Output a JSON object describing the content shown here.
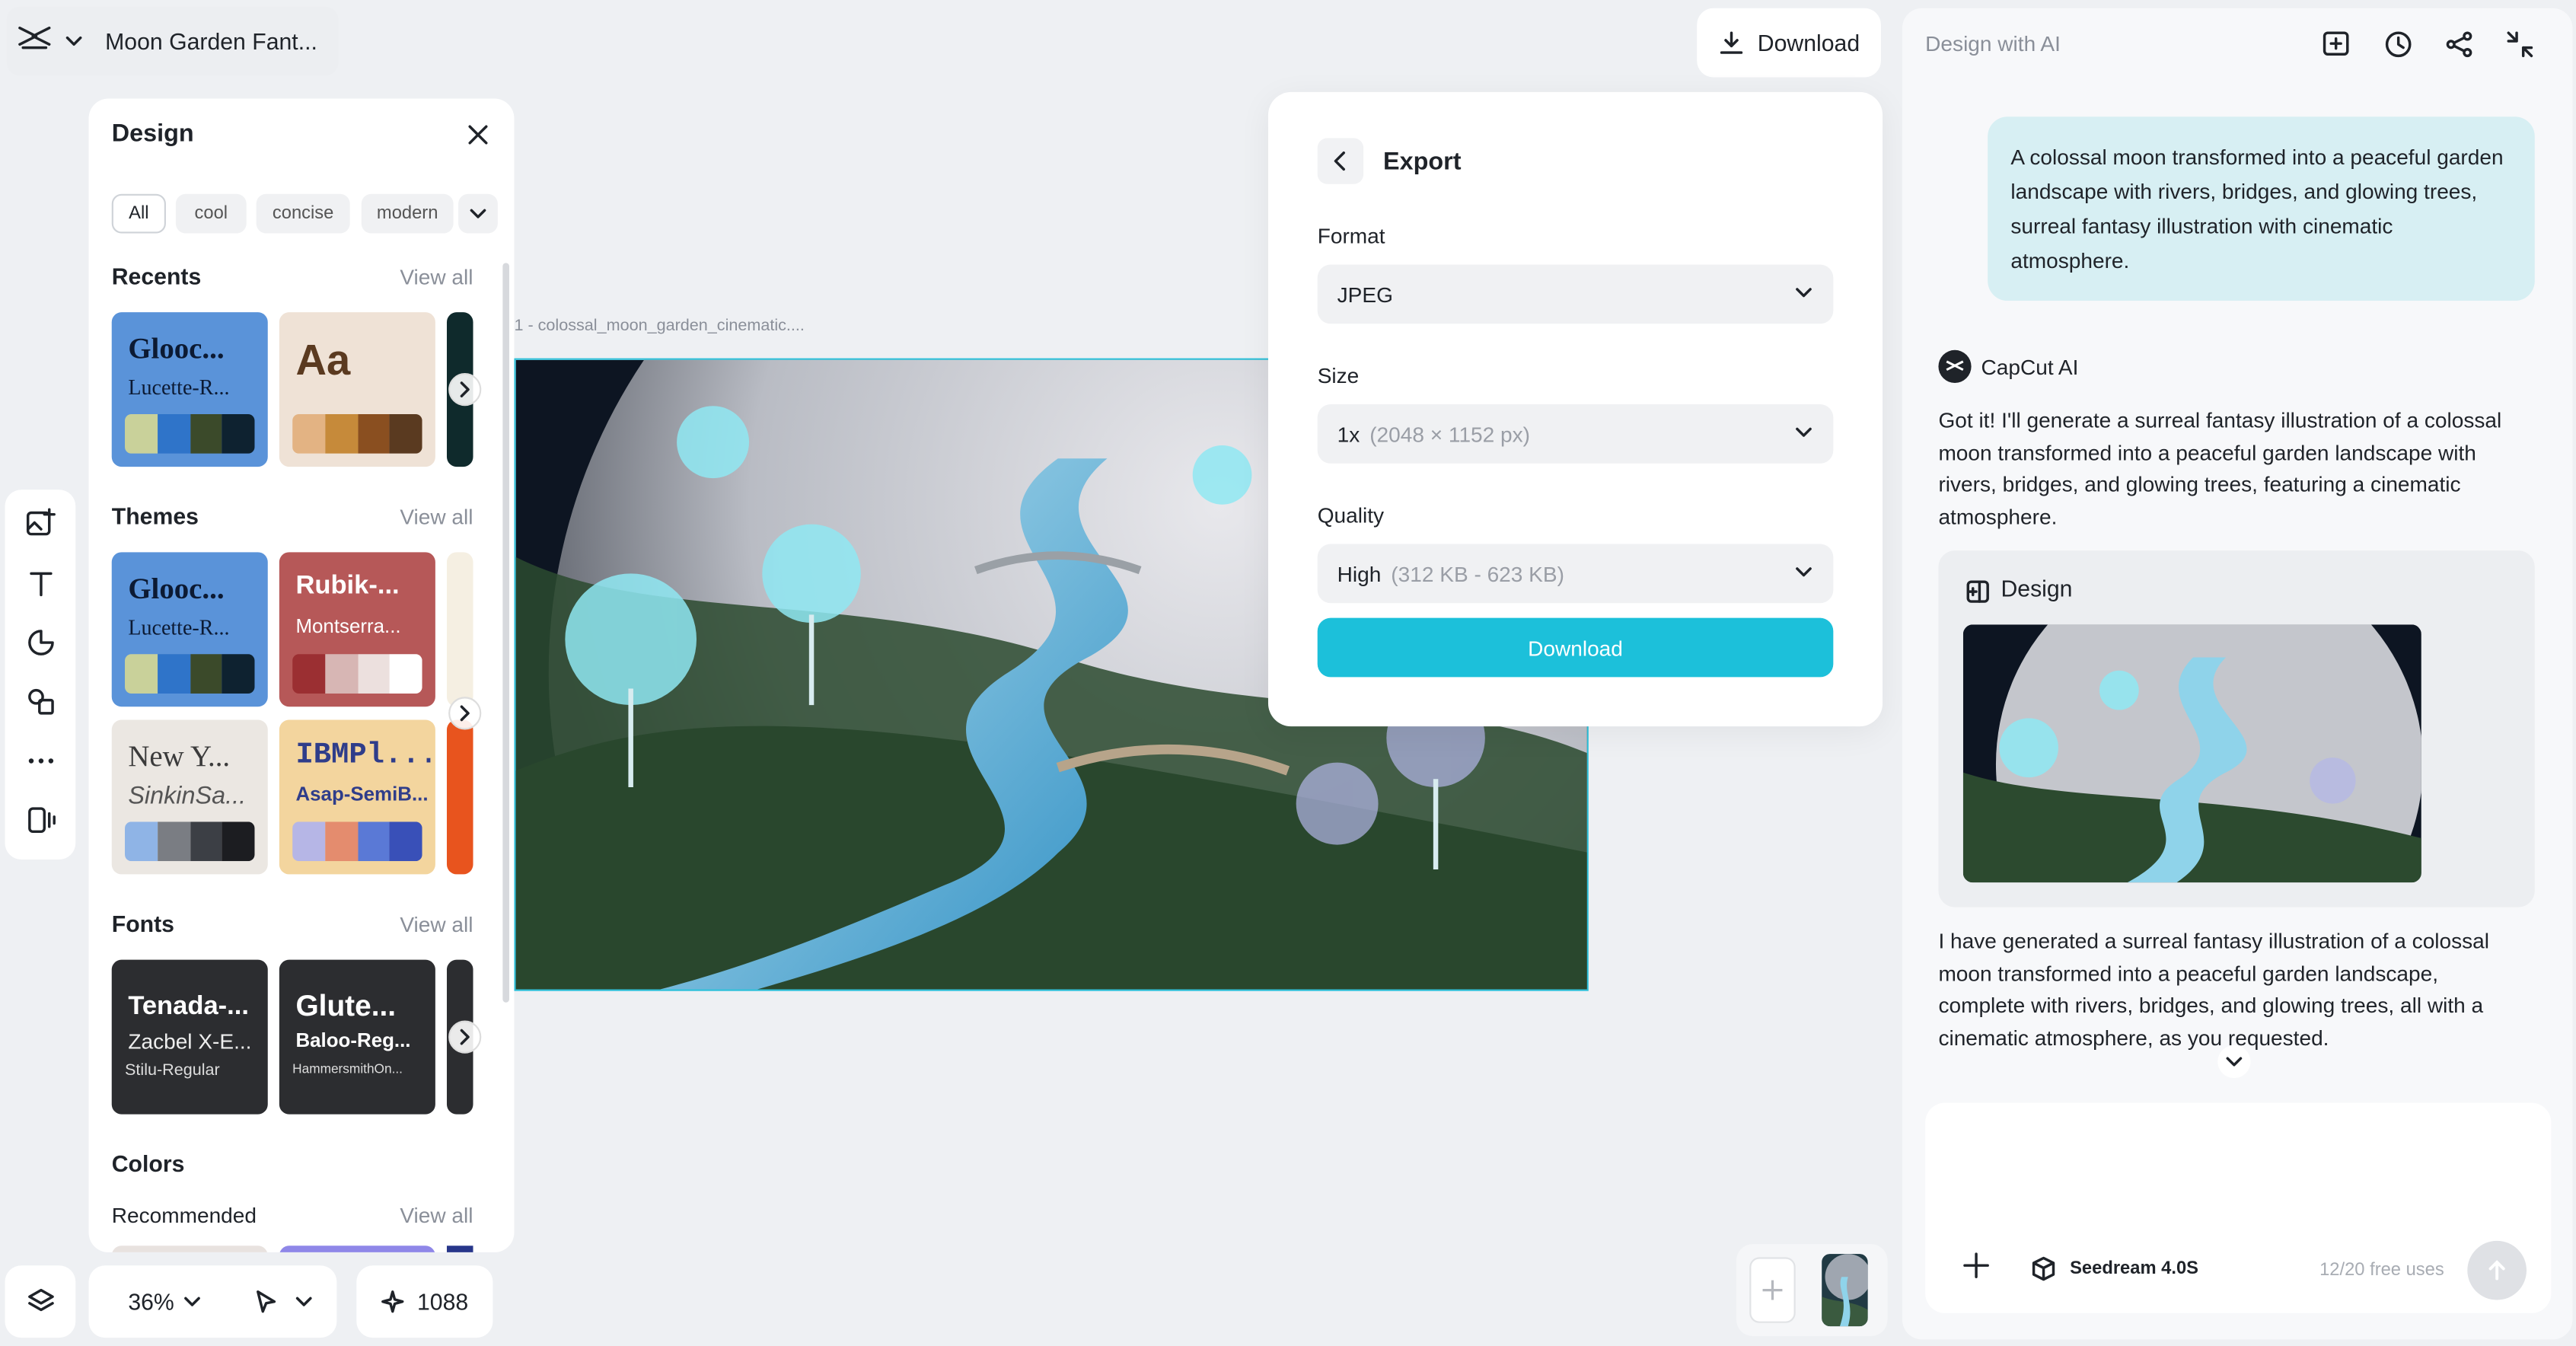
{
  "app": {
    "project_title": "Moon Garden Fant...",
    "top_download_label": "Download"
  },
  "design_panel": {
    "title": "Design",
    "chips": [
      "All",
      "cool",
      "concise",
      "modern"
    ],
    "recents": {
      "title": "Recents",
      "view_all": "View all",
      "tiles": [
        {
          "heading": "Glooc...",
          "sub": "Lucette-R...",
          "bg": "#5a93d9",
          "fg": "#0c1a33",
          "swatches": [
            "#c9d19a",
            "#2f74c9",
            "#3b4a2a",
            "#0e2230"
          ]
        },
        {
          "heading": "Aa",
          "sub": "",
          "bg": "#efe2d6",
          "fg": "#5b3a20",
          "swatches": [
            "#e3b383",
            "#c68a3a",
            "#8a4f20",
            "#5a3a20"
          ]
        }
      ]
    },
    "themes": {
      "title": "Themes",
      "view_all": "View all",
      "tiles": [
        {
          "heading": "Glooc...",
          "sub": "Lucette-R...",
          "bg": "#5a93d9",
          "fg": "#0c1a33",
          "swatches": [
            "#c9d19a",
            "#2f74c9",
            "#3b4a2a",
            "#0e2230"
          ]
        },
        {
          "heading": "Rubik-...",
          "sub": "Montserra...",
          "bg": "#b65858",
          "fg": "#ffffff",
          "swatches": [
            "#9b2f32",
            "#d7b6b4",
            "#ece0de",
            "#ffffff"
          ]
        },
        {
          "heading": "New Y...",
          "sub": "SinkinSa...",
          "bg": "#ebe7e2",
          "fg": "#3b3b3b",
          "swatches": [
            "#8fb4e6",
            "#7a7d83",
            "#3c3f45",
            "#1c1d21"
          ]
        },
        {
          "heading": "IBMPl...",
          "sub": "Asap-SemiB...",
          "bg": "#f3d59e",
          "fg": "#2f3d8a",
          "swatches": [
            "#b6b6e6",
            "#e48c6e",
            "#5a79d6",
            "#3950b8"
          ]
        }
      ]
    },
    "fonts": {
      "title": "Fonts",
      "view_all": "View all",
      "tiles": [
        {
          "heading": "Tenada-...",
          "sub": "Zacbel X-E...",
          "small": "Stilu-Regular"
        },
        {
          "heading": "Glute...",
          "sub": "Baloo-Reg...",
          "small": "HammersmithOn..."
        }
      ]
    },
    "colors": {
      "title": "Colors",
      "subtitle": "Recommended",
      "view_all": "View all"
    }
  },
  "canvas": {
    "label": "1 -  colossal_moon_garden_cinematic...."
  },
  "export": {
    "title": "Export",
    "format_label": "Format",
    "format_value": "JPEG",
    "size_label": "Size",
    "size_value": "1x",
    "size_hint": "(2048 × 1152 px)",
    "quality_label": "Quality",
    "quality_value": "High",
    "quality_hint": "(312 KB - 623 KB)",
    "download_label": "Download"
  },
  "ai": {
    "header": "Design with AI",
    "user_prompt": "A colossal moon transformed into a peaceful garden landscape with rivers, bridges, and glowing trees, surreal fantasy illustration with cinematic atmosphere.",
    "assistant_name": "CapCut AI",
    "reply_1": "Got it! I'll generate a surreal fantasy illustration of a colossal moon transformed into a peaceful garden landscape with rivers, bridges, and glowing trees, featuring a cinematic atmosphere.",
    "design_card_label": "Design",
    "reply_2": "I have generated a surreal fantasy illustration of a colossal moon transformed into a peaceful garden landscape, complete with rivers, bridges, and glowing trees, all with a cinematic atmosphere, as you requested.",
    "model_name": "Seedream 4.0S",
    "free_uses": "12/20 free uses"
  },
  "bottom": {
    "zoom": "36%",
    "credits": "1088"
  },
  "colors": {
    "accent": "#1cc0da",
    "bubble": "#d7eff3",
    "canvas_border": "#2bc0d9"
  }
}
